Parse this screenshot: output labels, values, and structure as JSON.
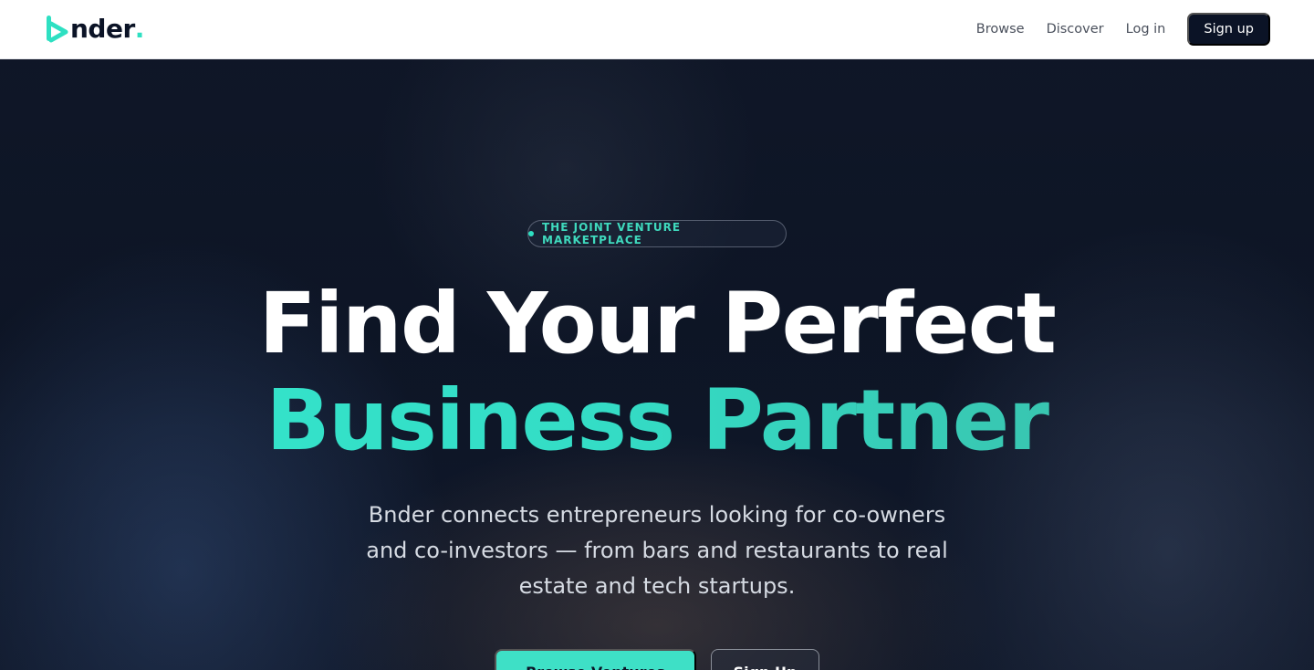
{
  "brand": {
    "logo_text": "nder",
    "logo_dot": ".",
    "accent_color": "#2ee0c2",
    "dark_color": "#0b1326"
  },
  "nav": {
    "links": [
      "Browse",
      "Discover",
      "Log in"
    ],
    "cta_label": "Sign up"
  },
  "hero": {
    "badge": "THE JOINT VENTURE MARKETPLACE",
    "headline_line1": "Find Your Perfect",
    "headline_line2": "Business Partner",
    "subtitle": "Bnder connects entrepreneurs looking for co-owners and co-investors — from bars and restaurants to real estate and tech startups.",
    "primary_button": "Browse Ventures",
    "secondary_button": "Sign Up"
  }
}
